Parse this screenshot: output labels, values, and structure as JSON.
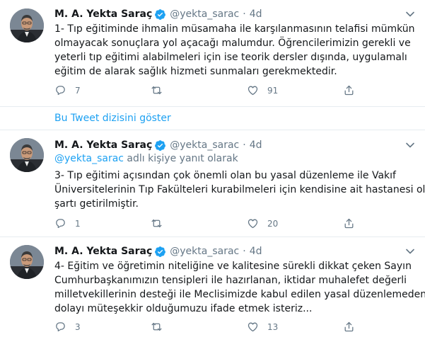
{
  "tweets": [
    {
      "name": "M. A. Yekta Saraç",
      "handle": "@yekta_sarac",
      "separator": "·",
      "time": "4d",
      "reply_to": null,
      "lines": [
        "1- Tıp eğitiminde ihmalin müsamaha ile karşılanmasının telafisi mümkün",
        "olmayacak sonuçlara yol açacağı malumdur. Öğrencilerimizin gerekli ve",
        "yeterli tıp eğitimi alabilmeleri için ise teorik dersler dışında, uygulamalı",
        "eğitim de alarak sağlık hizmeti sunmaları gerekmektedir."
      ],
      "replies": "7",
      "retweets": "",
      "likes": "91"
    },
    {
      "name": "M. A. Yekta Saraç",
      "handle": "@yekta_sarac",
      "separator": "·",
      "time": "4d",
      "reply_to": {
        "link": "@yekta_sarac",
        "rest": " adlı kişiye yanıt olarak"
      },
      "lines": [
        "3- Tıp eğitimi açısından çok önemli olan bu yasal düzenleme ile Vakıf",
        "Üniversitelerinin Tıp Fakülteleri kurabilmeleri için kendisine ait hastanesi olma",
        "şartı getirilmiştir."
      ],
      "replies": "1",
      "retweets": "",
      "likes": "20"
    },
    {
      "name": "M. A. Yekta Saraç",
      "handle": "@yekta_sarac",
      "separator": "·",
      "time": "4d",
      "reply_to": null,
      "lines": [
        "4- Eğitim ve öğretimin niteliğine ve kalitesine sürekli dikkat çeken Sayın",
        "Cumhurbaşkanımızın tensipleri ile hazırlanan, iktidar muhalefet değerli",
        "milletvekillerinin desteği ile Meclisimizde kabul edilen yasal düzenlemeden",
        "dolayı müteşekkir olduğumuzu ifade etmek isteriz..."
      ],
      "replies": "3",
      "retweets": "",
      "likes": "13"
    }
  ],
  "thread_link": "Bu Tweet dizisini göster",
  "icons": {
    "verified": "verified-badge-icon",
    "caret": "chevron-down-icon",
    "reply": "reply-icon",
    "retweet": "retweet-icon",
    "like": "heart-icon",
    "share": "share-icon"
  },
  "colors": {
    "accent": "#1da1f2",
    "secondary_text": "#657786",
    "text": "#14171a",
    "divider": "#e6ecf0"
  }
}
